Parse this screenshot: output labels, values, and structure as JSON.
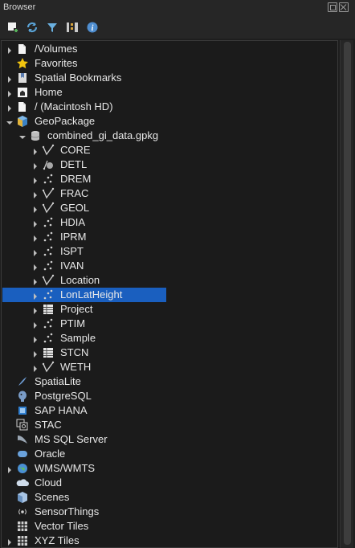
{
  "panel": {
    "title": "Browser"
  },
  "toolbar": [
    {
      "name": "add-layer-icon"
    },
    {
      "name": "refresh-icon"
    },
    {
      "name": "filter-icon"
    },
    {
      "name": "collapse-all-icon"
    },
    {
      "name": "info-icon"
    }
  ],
  "tree": [
    {
      "label": "/Volumes",
      "depth": 0,
      "arrow": "right",
      "icon": "folder"
    },
    {
      "label": "Favorites",
      "depth": 0,
      "arrow": "none",
      "icon": "star"
    },
    {
      "label": "Spatial Bookmarks",
      "depth": 0,
      "arrow": "right",
      "icon": "bookmark"
    },
    {
      "label": "Home",
      "depth": 0,
      "arrow": "right",
      "icon": "home"
    },
    {
      "label": "/ (Macintosh HD)",
      "depth": 0,
      "arrow": "right",
      "icon": "folder"
    },
    {
      "label": "GeoPackage",
      "depth": 0,
      "arrow": "down",
      "icon": "geopackage"
    },
    {
      "label": "combined_gi_data.gpkg",
      "depth": 1,
      "arrow": "down",
      "icon": "database"
    },
    {
      "label": "CORE",
      "depth": 2,
      "arrow": "right",
      "icon": "line"
    },
    {
      "label": "DETL",
      "depth": 2,
      "arrow": "right",
      "icon": "geometry"
    },
    {
      "label": "DREM",
      "depth": 2,
      "arrow": "right",
      "icon": "point"
    },
    {
      "label": "FRAC",
      "depth": 2,
      "arrow": "right",
      "icon": "line"
    },
    {
      "label": "GEOL",
      "depth": 2,
      "arrow": "right",
      "icon": "line"
    },
    {
      "label": "HDIA",
      "depth": 2,
      "arrow": "right",
      "icon": "point"
    },
    {
      "label": "IPRM",
      "depth": 2,
      "arrow": "right",
      "icon": "point"
    },
    {
      "label": "ISPT",
      "depth": 2,
      "arrow": "right",
      "icon": "point"
    },
    {
      "label": "IVAN",
      "depth": 2,
      "arrow": "right",
      "icon": "point"
    },
    {
      "label": "Location",
      "depth": 2,
      "arrow": "right",
      "icon": "line"
    },
    {
      "label": "LonLatHeight",
      "depth": 2,
      "arrow": "right",
      "icon": "point",
      "selected": true
    },
    {
      "label": "Project",
      "depth": 2,
      "arrow": "right",
      "icon": "table"
    },
    {
      "label": "PTIM",
      "depth": 2,
      "arrow": "right",
      "icon": "point"
    },
    {
      "label": "Sample",
      "depth": 2,
      "arrow": "right",
      "icon": "point"
    },
    {
      "label": "STCN",
      "depth": 2,
      "arrow": "right",
      "icon": "table"
    },
    {
      "label": "WETH",
      "depth": 2,
      "arrow": "right",
      "icon": "line"
    },
    {
      "label": "SpatiaLite",
      "depth": 0,
      "arrow": "none",
      "icon": "spatialite"
    },
    {
      "label": "PostgreSQL",
      "depth": 0,
      "arrow": "none",
      "icon": "postgresql"
    },
    {
      "label": "SAP HANA",
      "depth": 0,
      "arrow": "none",
      "icon": "hana"
    },
    {
      "label": "STAC",
      "depth": 0,
      "arrow": "none",
      "icon": "stac"
    },
    {
      "label": "MS SQL Server",
      "depth": 0,
      "arrow": "none",
      "icon": "mssql"
    },
    {
      "label": "Oracle",
      "depth": 0,
      "arrow": "none",
      "icon": "oracle"
    },
    {
      "label": "WMS/WMTS",
      "depth": 0,
      "arrow": "right",
      "icon": "globe"
    },
    {
      "label": "Cloud",
      "depth": 0,
      "arrow": "none",
      "icon": "cloud"
    },
    {
      "label": "Scenes",
      "depth": 0,
      "arrow": "none",
      "icon": "scenes"
    },
    {
      "label": "SensorThings",
      "depth": 0,
      "arrow": "none",
      "icon": "sensor"
    },
    {
      "label": "Vector Tiles",
      "depth": 0,
      "arrow": "none",
      "icon": "grid"
    },
    {
      "label": "XYZ Tiles",
      "depth": 0,
      "arrow": "right",
      "icon": "grid"
    }
  ]
}
